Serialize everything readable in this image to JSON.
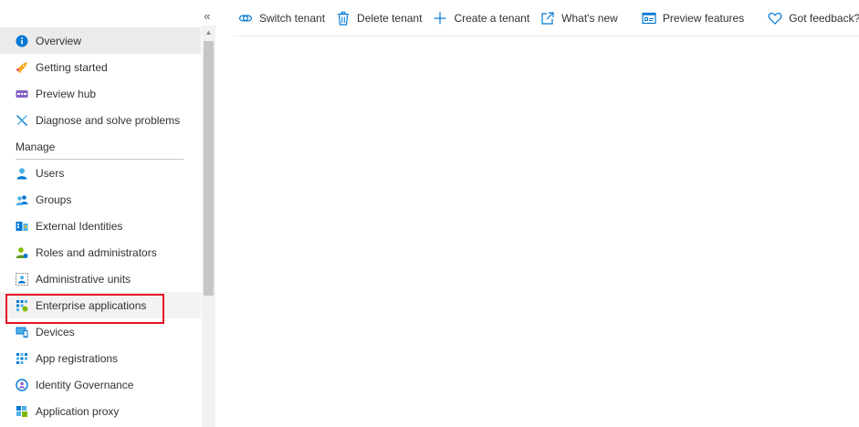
{
  "sidebar": {
    "collapse_glyph": "«",
    "items_top": [
      {
        "label": "Overview",
        "icon": "info-icon",
        "selected": true
      },
      {
        "label": "Getting started",
        "icon": "rocket-icon"
      },
      {
        "label": "Preview hub",
        "icon": "preview-hub-icon"
      },
      {
        "label": "Diagnose and solve problems",
        "icon": "wrench-icon"
      }
    ],
    "manage_section": {
      "title": "Manage",
      "items": [
        {
          "label": "Users",
          "icon": "user-icon"
        },
        {
          "label": "Groups",
          "icon": "groups-icon"
        },
        {
          "label": "External Identities",
          "icon": "external-identities-icon"
        },
        {
          "label": "Roles and administrators",
          "icon": "roles-icon"
        },
        {
          "label": "Administrative units",
          "icon": "admin-units-icon"
        },
        {
          "label": "Enterprise applications",
          "icon": "enterprise-apps-icon",
          "highlighted": true
        },
        {
          "label": "Devices",
          "icon": "devices-icon"
        },
        {
          "label": "App registrations",
          "icon": "app-registrations-icon"
        },
        {
          "label": "Identity Governance",
          "icon": "identity-governance-icon"
        },
        {
          "label": "Application proxy",
          "icon": "application-proxy-icon"
        }
      ]
    }
  },
  "toolbar": {
    "switch_tenant": "Switch tenant",
    "delete_tenant": "Delete tenant",
    "create_tenant": "Create a tenant",
    "whats_new": "What's new",
    "preview_features": "Preview features",
    "got_feedback": "Got feedback?"
  },
  "colors": {
    "accent": "#0078d4",
    "highlight_border": "#e81123",
    "selected_bg": "#edebe9"
  }
}
